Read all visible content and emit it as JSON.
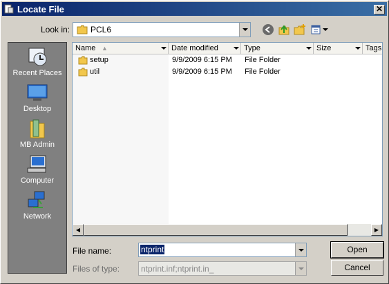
{
  "window": {
    "title": "Locate File"
  },
  "lookin": {
    "label": "Look in:",
    "value": "PCL6"
  },
  "places": [
    {
      "label": "Recent Places",
      "icon": "recent-places-icon"
    },
    {
      "label": "Desktop",
      "icon": "desktop-icon"
    },
    {
      "label": "MB Admin",
      "icon": "user-folder-icon"
    },
    {
      "label": "Computer",
      "icon": "computer-icon"
    },
    {
      "label": "Network",
      "icon": "network-icon"
    }
  ],
  "columns": [
    "Name",
    "Date modified",
    "Type",
    "Size",
    "Tags"
  ],
  "files": [
    {
      "name": "setup",
      "date": "9/9/2009 6:15 PM",
      "type": "File Folder"
    },
    {
      "name": "util",
      "date": "9/9/2009 6:15 PM",
      "type": "File Folder"
    }
  ],
  "filename": {
    "label": "File name:",
    "value": "ntprint"
  },
  "filetype": {
    "label": "Files of type:",
    "value": "ntprint.inf;ntprint.in_"
  },
  "buttons": {
    "open": "Open",
    "cancel": "Cancel"
  },
  "colors": {
    "titlebar": "#0a246a",
    "selection": "#0a246a",
    "panel": "#808080",
    "face": "#d4d0c8"
  }
}
